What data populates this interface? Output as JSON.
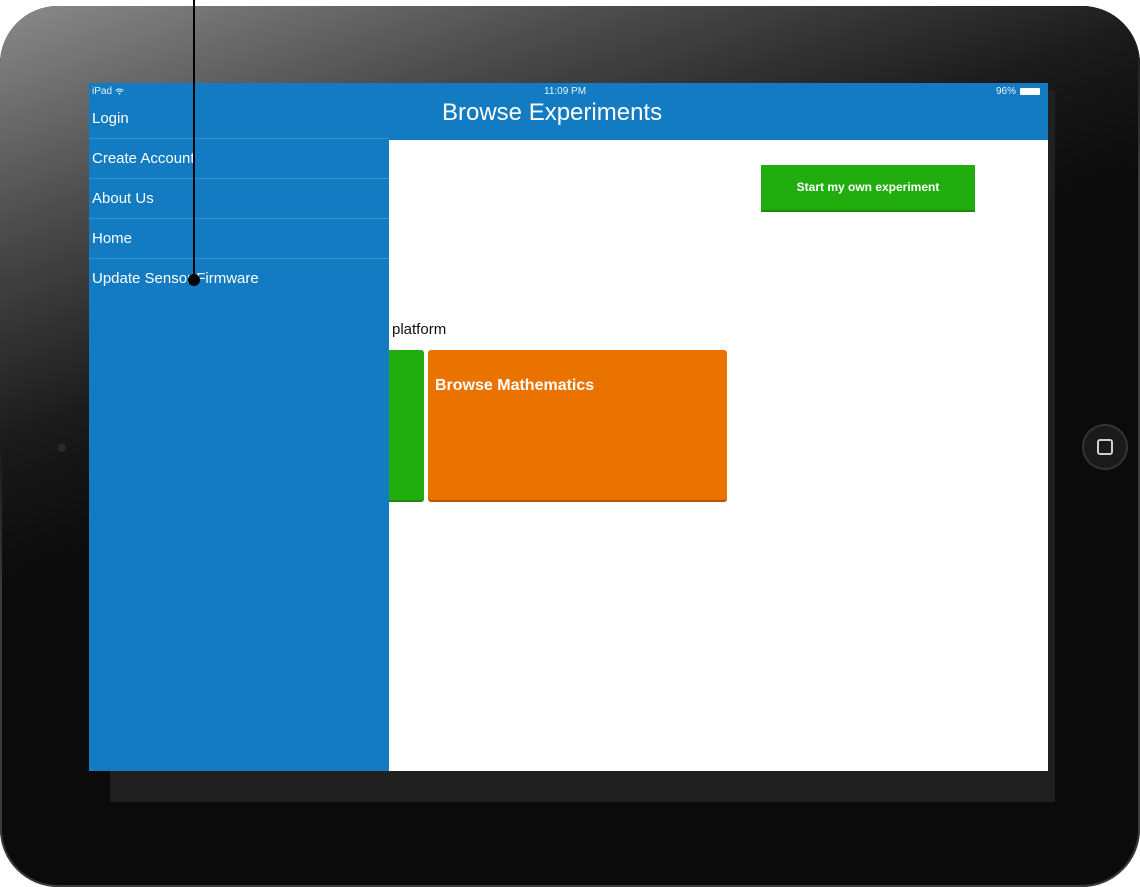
{
  "status_bar": {
    "device": "iPad",
    "time": "11:09 PM",
    "battery": "96%"
  },
  "sidebar": {
    "items": [
      {
        "label": "Login"
      },
      {
        "label": "Create Account"
      },
      {
        "label": "About Us"
      },
      {
        "label": "Home"
      },
      {
        "label": "Update Sensor Firmware"
      }
    ]
  },
  "header": {
    "title": "Browse Experiments"
  },
  "main": {
    "start_button_label": "Start my own experiment",
    "platform_label": "platform",
    "tiles": [
      {
        "label": "",
        "color": "#22ad0f"
      },
      {
        "label": "Browse Mathematics",
        "color": "#ea7300"
      }
    ]
  },
  "colors": {
    "nav_blue": "#137bc1",
    "green": "#22ad0f",
    "orange": "#ea7300"
  },
  "icons": {
    "wifi": "wifi-icon",
    "battery": "battery-icon",
    "home": "home-button-icon"
  }
}
